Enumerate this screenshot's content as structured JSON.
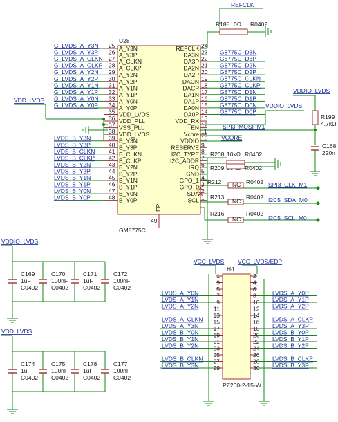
{
  "u28": {
    "ref": "U28",
    "part": "GM8775C",
    "ep_pin": "49",
    "ep_label": "EP",
    "left_pins": [
      {
        "num": "25",
        "name": "A_Y3N",
        "net": "G_LVDS_A_Y3N"
      },
      {
        "num": "26",
        "name": "A_Y3P",
        "net": "G_LVDS_A_Y3P"
      },
      {
        "num": "27",
        "name": "A_CLKN",
        "net": "G_LVDS_A_CLKN"
      },
      {
        "num": "28",
        "name": "A_CLKP",
        "net": "G_LVDS_A_CLKP"
      },
      {
        "num": "29",
        "name": "A_Y2N",
        "net": "G_LVDS_A_Y2N"
      },
      {
        "num": "30",
        "name": "A_Y2P",
        "net": "G_LVDS_A_Y2P"
      },
      {
        "num": "31",
        "name": "A_Y1N",
        "net": "G_LVDS_A_Y1N"
      },
      {
        "num": "32",
        "name": "A_Y1P",
        "net": "G_LVDS_A_Y1P"
      },
      {
        "num": "33",
        "name": "A_Y0N",
        "net": "G_LVDS_A_Y0N"
      },
      {
        "num": "34",
        "name": "A_Y0P",
        "net": "G_LVDS_A_Y0P"
      },
      {
        "num": "35",
        "name": "VDD_LVDS",
        "net": ""
      },
      {
        "num": "36",
        "name": "VDD_PLL",
        "net": ""
      },
      {
        "num": "37",
        "name": "VSS_PLL",
        "net": ""
      },
      {
        "num": "38",
        "name": "VDD_LVDS",
        "net": ""
      },
      {
        "num": "39",
        "name": "B_Y3N",
        "net": "LVDS_B_Y3N"
      },
      {
        "num": "40",
        "name": "B_Y3P",
        "net": "LVDS_B_Y3P"
      },
      {
        "num": "41",
        "name": "B_CLKN",
        "net": "LVDS_B_CLKN"
      },
      {
        "num": "42",
        "name": "B_CLKP",
        "net": "LVDS_B_CLKP"
      },
      {
        "num": "43",
        "name": "B_Y2N",
        "net": "LVDS_B_Y2N"
      },
      {
        "num": "44",
        "name": "B_Y2P",
        "net": "LVDS_B_Y2P"
      },
      {
        "num": "45",
        "name": "B_Y1N",
        "net": "LVDS_B_Y1N"
      },
      {
        "num": "46",
        "name": "B_Y1P",
        "net": "LVDS_B_Y1P"
      },
      {
        "num": "47",
        "name": "B_Y0N",
        "net": "LVDS_B_Y0N"
      },
      {
        "num": "48",
        "name": "B_Y0P",
        "net": "LVDS_B_Y0P"
      }
    ],
    "right_pins": [
      {
        "num": "24",
        "name": "REFCLK"
      },
      {
        "num": "23",
        "name": "DA3N"
      },
      {
        "num": "22",
        "name": "DA3P"
      },
      {
        "num": "21",
        "name": "DA2N"
      },
      {
        "num": "20",
        "name": "DA2P"
      },
      {
        "num": "19",
        "name": "DACN"
      },
      {
        "num": "18",
        "name": "DACP"
      },
      {
        "num": "17",
        "name": "DA1N"
      },
      {
        "num": "16",
        "name": "DA1P"
      },
      {
        "num": "15",
        "name": "DA0N"
      },
      {
        "num": "14",
        "name": "DA0P"
      },
      {
        "num": "13",
        "name": "VDD_RX"
      },
      {
        "num": "12",
        "name": "EN"
      },
      {
        "num": "11",
        "name": "Vcore"
      },
      {
        "num": "10",
        "name": "VDDIO"
      },
      {
        "num": "9",
        "name": "RESERVE"
      },
      {
        "num": "8",
        "name": "I2C_TYPE"
      },
      {
        "num": "7",
        "name": "I2C_ADDR"
      },
      {
        "num": "6",
        "name": "IRQ"
      },
      {
        "num": "5",
        "name": "GND"
      },
      {
        "num": "4",
        "name": "GPO_1"
      },
      {
        "num": "3",
        "name": "GPO_0"
      },
      {
        "num": "2",
        "name": "SDA"
      },
      {
        "num": "1",
        "name": "SCL"
      }
    ],
    "right_nets": [
      "G8775C_D3N",
      "G8775C_D3P",
      "G8775C_D2N",
      "G8775C_D2P",
      "G8775C_CLKN",
      "G8775C_CLKP",
      "G8775C_D1N",
      "G8775C_D1P",
      "G8775C_D0N",
      "G8775C_D0P"
    ]
  },
  "nets": {
    "refclk": "REFCLK",
    "vdd_lvds": "VDD_LVDS",
    "vddio_lvds": "VDDIO_LVDS",
    "spi3_mosi": "SPI3_MOSI_M1",
    "vcore": "VCORE",
    "spi3_clk": "SPI3_CLK_M1",
    "i2c5_sda": "I2C5_SDA_M0",
    "i2c5_scl": "I2C5_SCL_M0",
    "vcc_lvds": "VCC_LVDS",
    "vcc_lvds_edp": "VCC_LVDS/EDP"
  },
  "resistors": [
    {
      "ref": "R188",
      "value": "0Ω",
      "pkg": "R0402"
    },
    {
      "ref": "R208",
      "value": "10kΩ",
      "pkg": "R0402"
    },
    {
      "ref": "R209",
      "value": "10kΩ",
      "pkg": "R0402"
    },
    {
      "ref": "R212",
      "value": "NC",
      "pkg": "R0402"
    },
    {
      "ref": "R213",
      "value": "NC",
      "pkg": "R0402"
    },
    {
      "ref": "R216",
      "value": "NC",
      "pkg": "R0402"
    },
    {
      "ref": "R199",
      "value": "4.7kΩ",
      "pkg": ""
    }
  ],
  "c168": {
    "ref": "C168",
    "value": "220n"
  },
  "caps_row1": [
    {
      "ref": "C169",
      "value": "1uF",
      "pkg": "C0402"
    },
    {
      "ref": "C170",
      "value": "100nF",
      "pkg": "C0402"
    },
    {
      "ref": "C171",
      "value": "1uF",
      "pkg": "C0402"
    },
    {
      "ref": "C172",
      "value": "100nF",
      "pkg": "C0402"
    }
  ],
  "caps_row2": [
    {
      "ref": "C174",
      "value": "1uF",
      "pkg": "C0402"
    },
    {
      "ref": "C175",
      "value": "100nF",
      "pkg": "C0402"
    },
    {
      "ref": "C178",
      "value": "1uF",
      "pkg": "C0402"
    },
    {
      "ref": "C177",
      "value": "100nF",
      "pkg": "C0402"
    }
  ],
  "h4": {
    "ref": "H4",
    "part": "PZ200-2-15-W",
    "odd": [
      "1",
      "3",
      "5",
      "7",
      "9",
      "11",
      "13",
      "15",
      "17",
      "19",
      "21",
      "23",
      "25",
      "27",
      "29"
    ],
    "even": [
      "2",
      "4",
      "6",
      "8",
      "10",
      "12",
      "14",
      "16",
      "18",
      "20",
      "22",
      "24",
      "26",
      "28",
      "30"
    ],
    "left_nets": [
      {
        "row": 4,
        "net": "LVDS_A_Y0N"
      },
      {
        "row": 5,
        "net": "LVDS_A_Y1N"
      },
      {
        "row": 6,
        "net": "LVDS_A_Y2N"
      },
      {
        "row": 8,
        "net": "LVDS_A_CLKN"
      },
      {
        "row": 9,
        "net": "LVDS_A_Y3N"
      },
      {
        "row": 10,
        "net": "LVDS_B_Y0N"
      },
      {
        "row": 11,
        "net": "LVDS_B_Y1N"
      },
      {
        "row": 12,
        "net": "LVDS_B_Y2N"
      },
      {
        "row": 14,
        "net": "LVDS_B_CLKN"
      },
      {
        "row": 15,
        "net": "LVDS_B_Y3N"
      }
    ],
    "right_nets": [
      {
        "row": 4,
        "net": "LVDS_A_Y0P"
      },
      {
        "row": 5,
        "net": "LVDS_A_Y1P"
      },
      {
        "row": 6,
        "net": "LVDS_A_Y2P"
      },
      {
        "row": 8,
        "net": "LVDS_A_CLKP"
      },
      {
        "row": 9,
        "net": "LVDS_A_Y3P"
      },
      {
        "row": 10,
        "net": "LVDS_B_Y0P"
      },
      {
        "row": 11,
        "net": "LVDS_B_Y1P"
      },
      {
        "row": 12,
        "net": "LVDS_B_Y2P"
      },
      {
        "row": 14,
        "net": "LVDS_B_CLKP"
      },
      {
        "row": 15,
        "net": "LVDS_B_Y3P"
      }
    ]
  },
  "colors": {
    "wire": "#148a14",
    "net_label": "#1d2f9a",
    "part_outline": "#a03030",
    "part_fill": "#ffffcc"
  }
}
